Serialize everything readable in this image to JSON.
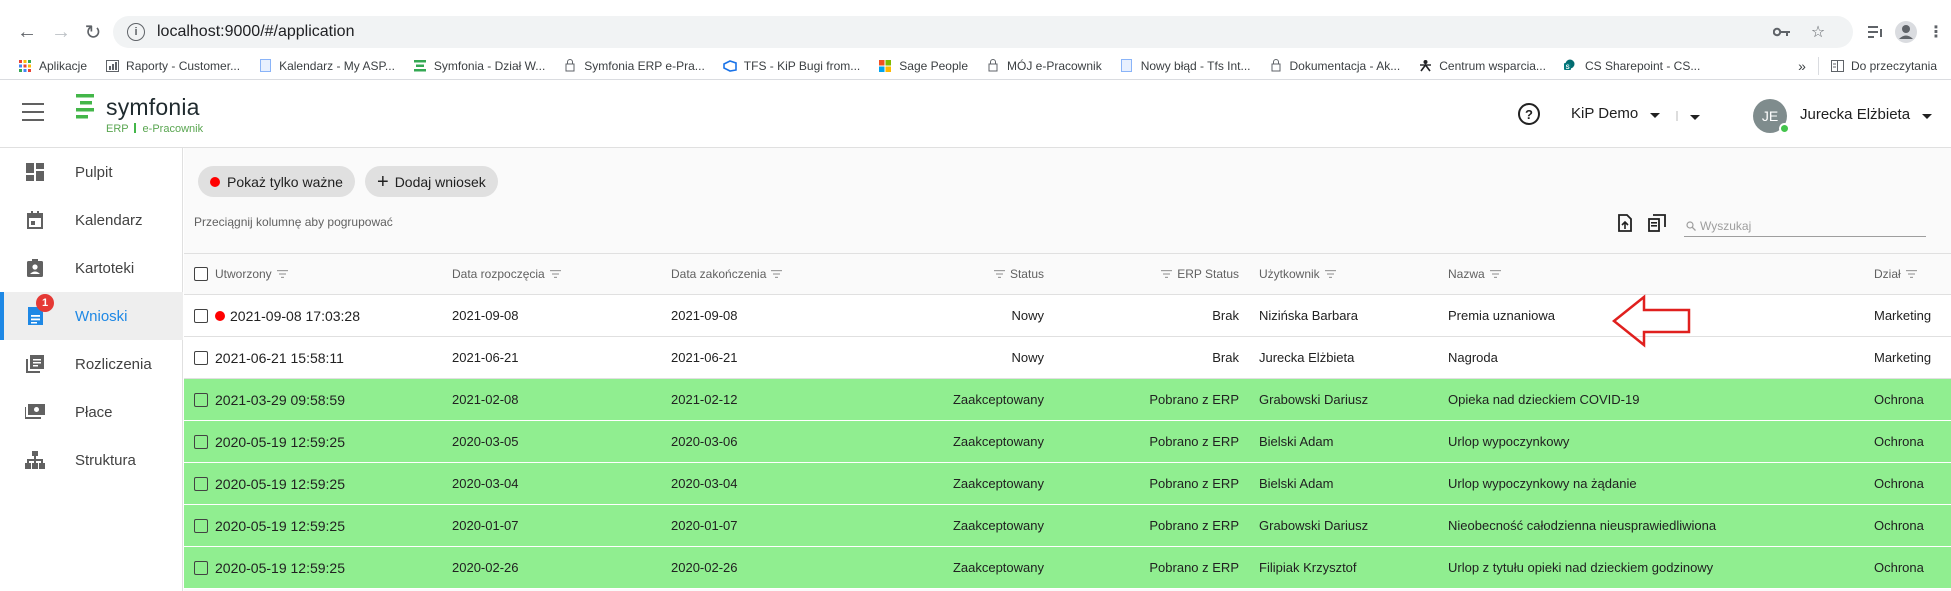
{
  "browser": {
    "url": "localhost:9000/#/application",
    "bookmarks": [
      {
        "label": "Aplikacje",
        "icon": "apps-grid-icon",
        "color": "#ea4335"
      },
      {
        "label": "Raporty - Customer...",
        "icon": "report-icon",
        "color": "#5f6368"
      },
      {
        "label": "Kalendarz - My ASP...",
        "icon": "page-icon",
        "color": "#8ab4f8"
      },
      {
        "label": "Symfonia - Dział W...",
        "icon": "symfonia-icon",
        "color": "#34a853"
      },
      {
        "label": "Symfonia ERP e-Pra...",
        "icon": "lock-icon",
        "color": "#5f6368"
      },
      {
        "label": "TFS - KiP Bugi from...",
        "icon": "tfs-icon",
        "color": "#1a73e8"
      },
      {
        "label": "Sage People",
        "icon": "windows-icon",
        "color": "#f25022"
      },
      {
        "label": "MÓJ e-Pracownik",
        "icon": "lock-icon",
        "color": "#5f6368"
      },
      {
        "label": "Nowy błąd - Tfs Int...",
        "icon": "page-icon",
        "color": "#8ab4f8"
      },
      {
        "label": "Dokumentacja - Ak...",
        "icon": "lock-icon",
        "color": "#5f6368"
      },
      {
        "label": "Centrum wsparcia...",
        "icon": "support-icon",
        "color": "#202124"
      },
      {
        "label": "CS Sharepoint - CS...",
        "icon": "sharepoint-icon",
        "color": "#038387"
      }
    ],
    "more_label": "»",
    "reading_list": "Do przeczytania"
  },
  "header": {
    "logo_name": "symfonia",
    "logo_sub_erp": "ERP",
    "logo_sub_product": "e-Pracownik",
    "company": "KiP Demo",
    "user_initials": "JE",
    "user_name": "Jurecka Elżbieta"
  },
  "sidebar": {
    "items": [
      {
        "label": "Pulpit",
        "icon": "dashboard-icon"
      },
      {
        "label": "Kalendarz",
        "icon": "calendar-icon"
      },
      {
        "label": "Kartoteki",
        "icon": "contact-badge-icon"
      },
      {
        "label": "Wnioski",
        "icon": "document-icon",
        "badge": "1",
        "active": true
      },
      {
        "label": "Rozliczenia",
        "icon": "library-books-icon"
      },
      {
        "label": "Płace",
        "icon": "payments-icon"
      },
      {
        "label": "Struktura",
        "icon": "org-structure-icon"
      }
    ]
  },
  "toolbar": {
    "important_label": "Pokaż tylko ważne",
    "add_label": "Dodaj wniosek",
    "group_hint": "Przeciągnij kolumnę aby pogrupować",
    "search_placeholder": "Wyszukaj"
  },
  "grid": {
    "columns": {
      "created": "Utworzony",
      "start": "Data rozpoczęcia",
      "end": "Data zakończenia",
      "status": "Status",
      "erp_status": "ERP Status",
      "user": "Użytkownik",
      "name": "Nazwa",
      "dept": "Dział"
    },
    "accepted_color": "#90ee90",
    "rows": [
      {
        "created": "2021-09-08 17:03:28",
        "important": true,
        "start": "2021-09-08",
        "end": "2021-09-08",
        "status": "Nowy",
        "erp_status": "Brak",
        "user": "Nizińska Barbara",
        "name": "Premia uznaniowa",
        "dept": "Marketing",
        "accepted": false
      },
      {
        "created": "2021-06-21 15:58:11",
        "important": false,
        "start": "2021-06-21",
        "end": "2021-06-21",
        "status": "Nowy",
        "erp_status": "Brak",
        "user": "Jurecka Elżbieta",
        "name": "Nagroda",
        "dept": "Marketing",
        "accepted": false
      },
      {
        "created": "2021-03-29 09:58:59",
        "important": false,
        "start": "2021-02-08",
        "end": "2021-02-12",
        "status": "Zaakceptowany",
        "erp_status": "Pobrano z ERP",
        "user": "Grabowski Dariusz",
        "name": "Opieka nad dzieckiem COVID-19",
        "dept": "Ochrona",
        "accepted": true
      },
      {
        "created": "2020-05-19 12:59:25",
        "important": false,
        "start": "2020-03-05",
        "end": "2020-03-06",
        "status": "Zaakceptowany",
        "erp_status": "Pobrano z ERP",
        "user": "Bielski Adam",
        "name": "Urlop wypoczynkowy",
        "dept": "Ochrona",
        "accepted": true
      },
      {
        "created": "2020-05-19 12:59:25",
        "important": false,
        "start": "2020-03-04",
        "end": "2020-03-04",
        "status": "Zaakceptowany",
        "erp_status": "Pobrano z ERP",
        "user": "Bielski Adam",
        "name": "Urlop wypoczynkowy na żądanie",
        "dept": "Ochrona",
        "accepted": true
      },
      {
        "created": "2020-05-19 12:59:25",
        "important": false,
        "start": "2020-01-07",
        "end": "2020-01-07",
        "status": "Zaakceptowany",
        "erp_status": "Pobrano z ERP",
        "user": "Grabowski Dariusz",
        "name": "Nieobecność całodzienna nieusprawiedliwiona",
        "dept": "Ochrona",
        "accepted": true
      },
      {
        "created": "2020-05-19 12:59:25",
        "important": false,
        "start": "2020-02-26",
        "end": "2020-02-26",
        "status": "Zaakceptowany",
        "erp_status": "Pobrano z ERP",
        "user": "Filipiak Krzysztof",
        "name": "Urlop z tytułu opieki nad dzieckiem godzinowy",
        "dept": "Ochrona",
        "accepted": true
      }
    ]
  },
  "annotation": {
    "icon": "red-outline-arrow-icon",
    "color": "#e0201e"
  }
}
